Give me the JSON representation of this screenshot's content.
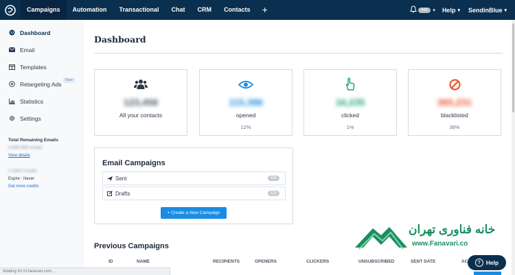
{
  "topbar": {
    "nav": [
      "Campaigns",
      "Automation",
      "Transactional",
      "Chat",
      "CRM",
      "Contacts"
    ],
    "add_symbol": "+",
    "notification_count": "441",
    "help_label": "Help",
    "account_label": "SendinBlue"
  },
  "sidebar": {
    "items": [
      {
        "label": "Dashboard",
        "icon": "globe-icon"
      },
      {
        "label": "Email",
        "icon": "envelope-icon"
      },
      {
        "label": "Templates",
        "icon": "layout-icon"
      },
      {
        "label": "Retargeting Ads",
        "icon": "target-icon",
        "badge": "New"
      },
      {
        "label": "Statistics",
        "icon": "bar-chart-icon"
      },
      {
        "label": "Settings",
        "icon": "gear-icon"
      }
    ],
    "remaining_title": "Total Remaining Emails",
    "remaining_value": "9,999,999 emails",
    "view_details": "View details",
    "credits": "0 SMS Credits",
    "expire": "Expire : Never",
    "get_credits": "Get more credits"
  },
  "main": {
    "title": "Dashboard",
    "stats": [
      {
        "value": "123,456",
        "label": "All your contacts",
        "pct": "",
        "color": "#2f3a4a",
        "icon": "users-icon"
      },
      {
        "value": "115,386",
        "label": "opened",
        "pct": "12%",
        "color": "#1a8ce3",
        "icon": "eye-icon"
      },
      {
        "value": "16,235",
        "label": "clicked",
        "pct": "1%",
        "color": "#1f9e7a",
        "icon": "pointer-hand-icon"
      },
      {
        "value": "365,231",
        "label": "blacklisted",
        "pct": "38%",
        "color": "#e8572b",
        "icon": "block-icon"
      }
    ],
    "email_campaigns": {
      "title": "Email Campaigns",
      "rows": [
        {
          "label": "Sent",
          "count": "429",
          "icon": "send-icon"
        },
        {
          "label": "Drafts",
          "count": "121",
          "icon": "edit-icon"
        }
      ],
      "create_button": "+ Create a New Campaign"
    },
    "previous_title": "Previous Campaigns",
    "columns": [
      "ID",
      "NAME",
      "RECIPIENTS",
      "OPENERS",
      "CLICKERS",
      "UNSUBSCRIBED",
      "SENT DATE",
      "AC"
    ]
  },
  "watermark": {
    "fa": "خانه فناوری تهران",
    "en": "www.Fanavari.co"
  },
  "help_button": "Help",
  "status_bar": "Waiting for ht.fanavari.com..."
}
